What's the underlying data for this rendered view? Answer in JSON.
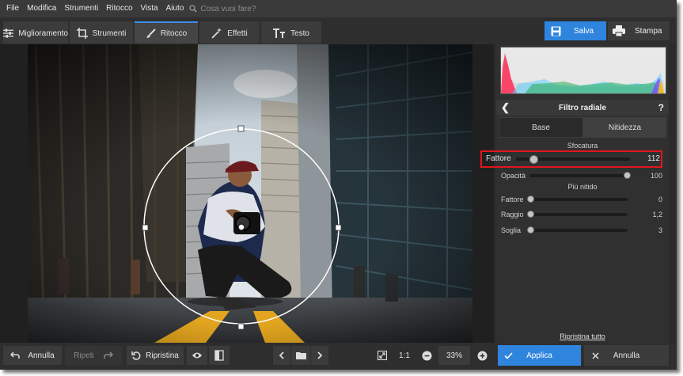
{
  "menubar": {
    "items": [
      "File",
      "Modifica",
      "Strumenti",
      "Ritocco",
      "Vista",
      "Aiuto"
    ],
    "search_placeholder": "Cosa vuoi fare?"
  },
  "toolbar": {
    "tabs": [
      {
        "label": "Miglioramento",
        "icon": "sliders-icon"
      },
      {
        "label": "Strumenti",
        "icon": "crop-icon"
      },
      {
        "label": "Ritocco",
        "icon": "brush-icon",
        "active": true
      },
      {
        "label": "Effetti",
        "icon": "magic-wand-icon"
      },
      {
        "label": "Testo",
        "icon": "text-icon"
      }
    ],
    "save_label": "Salva",
    "print_label": "Stampa",
    "accent": "#2f84de"
  },
  "panel": {
    "title": "Filtro radiale",
    "help": "?",
    "subtabs": [
      "Base",
      "Nitidezza"
    ],
    "active_subtab": "Nitidezza",
    "section_blur": "Sfocatura",
    "blur_factor": {
      "label": "Fattore",
      "value": "112",
      "fraction": 0.15
    },
    "opacity": {
      "label": "Opacità",
      "value": "100",
      "fraction": 1.0
    },
    "section_sharp": "Più nitido",
    "sharp": [
      {
        "label": "Fattore",
        "value": "0",
        "fraction": 0.0
      },
      {
        "label": "Raggio",
        "value": "1,2",
        "fraction": 0.0
      },
      {
        "label": "Soglia",
        "value": "3",
        "fraction": 0.0
      }
    ],
    "reset_all": "Ripristina tutto",
    "highlight_color": "#e0161e"
  },
  "bottom": {
    "undo": "Annulla",
    "redo": "Ripeti",
    "reset": "Ripristina",
    "zoom_fit": "1:1",
    "zoom": "33%",
    "apply": "Applica",
    "cancel": "Annulla"
  }
}
